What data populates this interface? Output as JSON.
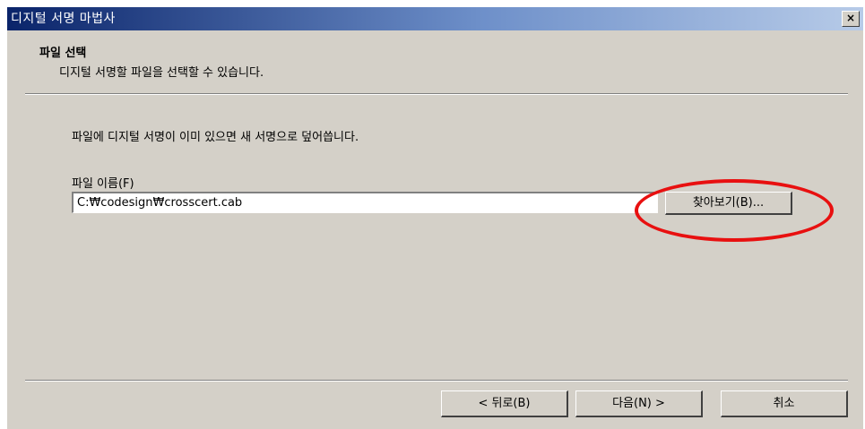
{
  "window": {
    "title": "디지털 서명 마법사",
    "close_label": "×"
  },
  "header": {
    "title": "파일 선택",
    "description": "디지털 서명할 파일을 선택할 수 있습니다."
  },
  "main": {
    "info_text": "파일에 디지털 서명이 이미 있으면 새 서명으로 덮어씁니다.",
    "file_label": "파일 이름(F)",
    "file_value": "C:₩codesign₩crosscert.cab",
    "browse_label": "찾아보기(B)..."
  },
  "footer": {
    "back_label": "< 뒤로(B)",
    "next_label": "다음(N) >",
    "cancel_label": "취소"
  },
  "colors": {
    "titlebar_start": "#0a246a",
    "face": "#d4d0c8",
    "highlight": "#e81010"
  }
}
